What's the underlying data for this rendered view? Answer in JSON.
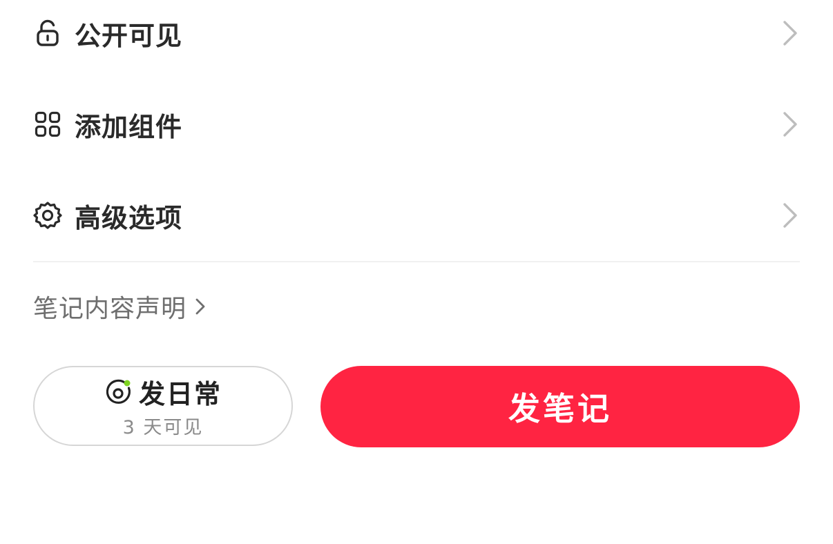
{
  "menu": {
    "items": [
      {
        "label": "公开可见",
        "icon": "unlock-icon"
      },
      {
        "label": "添加组件",
        "icon": "grid-icon"
      },
      {
        "label": "高级选项",
        "icon": "gear-icon"
      }
    ]
  },
  "declaration": {
    "label": "笔记内容声明",
    "icon": "chevron-right-icon"
  },
  "actions": {
    "daily": {
      "title": "发日常",
      "subtitle": "3 天可见",
      "icon": "daily-camera-icon",
      "dot_color": "#7ed321"
    },
    "publish": {
      "label": "发笔记",
      "color": "#ff2442"
    }
  },
  "colors": {
    "text_primary": "#2a2a2a",
    "text_secondary": "#6e6e6e",
    "chevron": "#bdbdbd",
    "accent": "#ff2442"
  }
}
